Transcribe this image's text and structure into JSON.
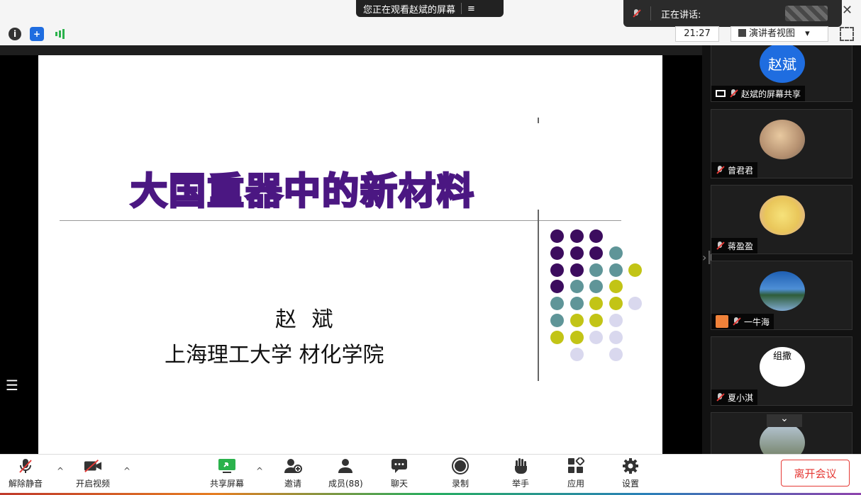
{
  "banner": {
    "text": "您正在观看赵斌的屏幕",
    "menu_icon": "≡"
  },
  "speaking": {
    "label": "正在讲话:"
  },
  "topbar": {
    "info_icon": "i",
    "shield_icon": "+",
    "time": "21:27",
    "view_label": "演讲者视图",
    "view_caret": "▾"
  },
  "slide": {
    "title": "大国重器中的新材料",
    "author": "赵 斌",
    "affiliation": "上海理工大学 材化学院",
    "dot_colors": {
      "purple": "#3c0c5e",
      "teal": "#5f9598",
      "yellow": "#c2c416",
      "lavender": "#d9d8ee"
    }
  },
  "sidebar": {
    "tiles": [
      {
        "avatar_text": "赵斌",
        "name": "赵斌的屏幕共享"
      },
      {
        "avatar_text": "",
        "name": "曾君君"
      },
      {
        "avatar_text": "",
        "name": "蒋盈盈"
      },
      {
        "avatar_text": "",
        "name": "一牛海"
      },
      {
        "avatar_text": "组撒",
        "name": "夏小淇"
      },
      {
        "avatar_text": "",
        "name": ""
      }
    ],
    "scroll_down_icon": "⌄"
  },
  "toolbar": {
    "unmute": "解除静音",
    "start_video": "开启视频",
    "share_screen": "共享屏幕",
    "invite": "邀请",
    "participants": "成员(88)",
    "chat": "聊天",
    "record": "录制",
    "raise_hand": "举手",
    "apps": "应用",
    "settings": "设置",
    "leave": "离开会议",
    "caret": "^"
  },
  "colors": {
    "accent_blue": "#1f6de0",
    "leave_red": "#e53935",
    "share_green": "#2bb24c"
  }
}
